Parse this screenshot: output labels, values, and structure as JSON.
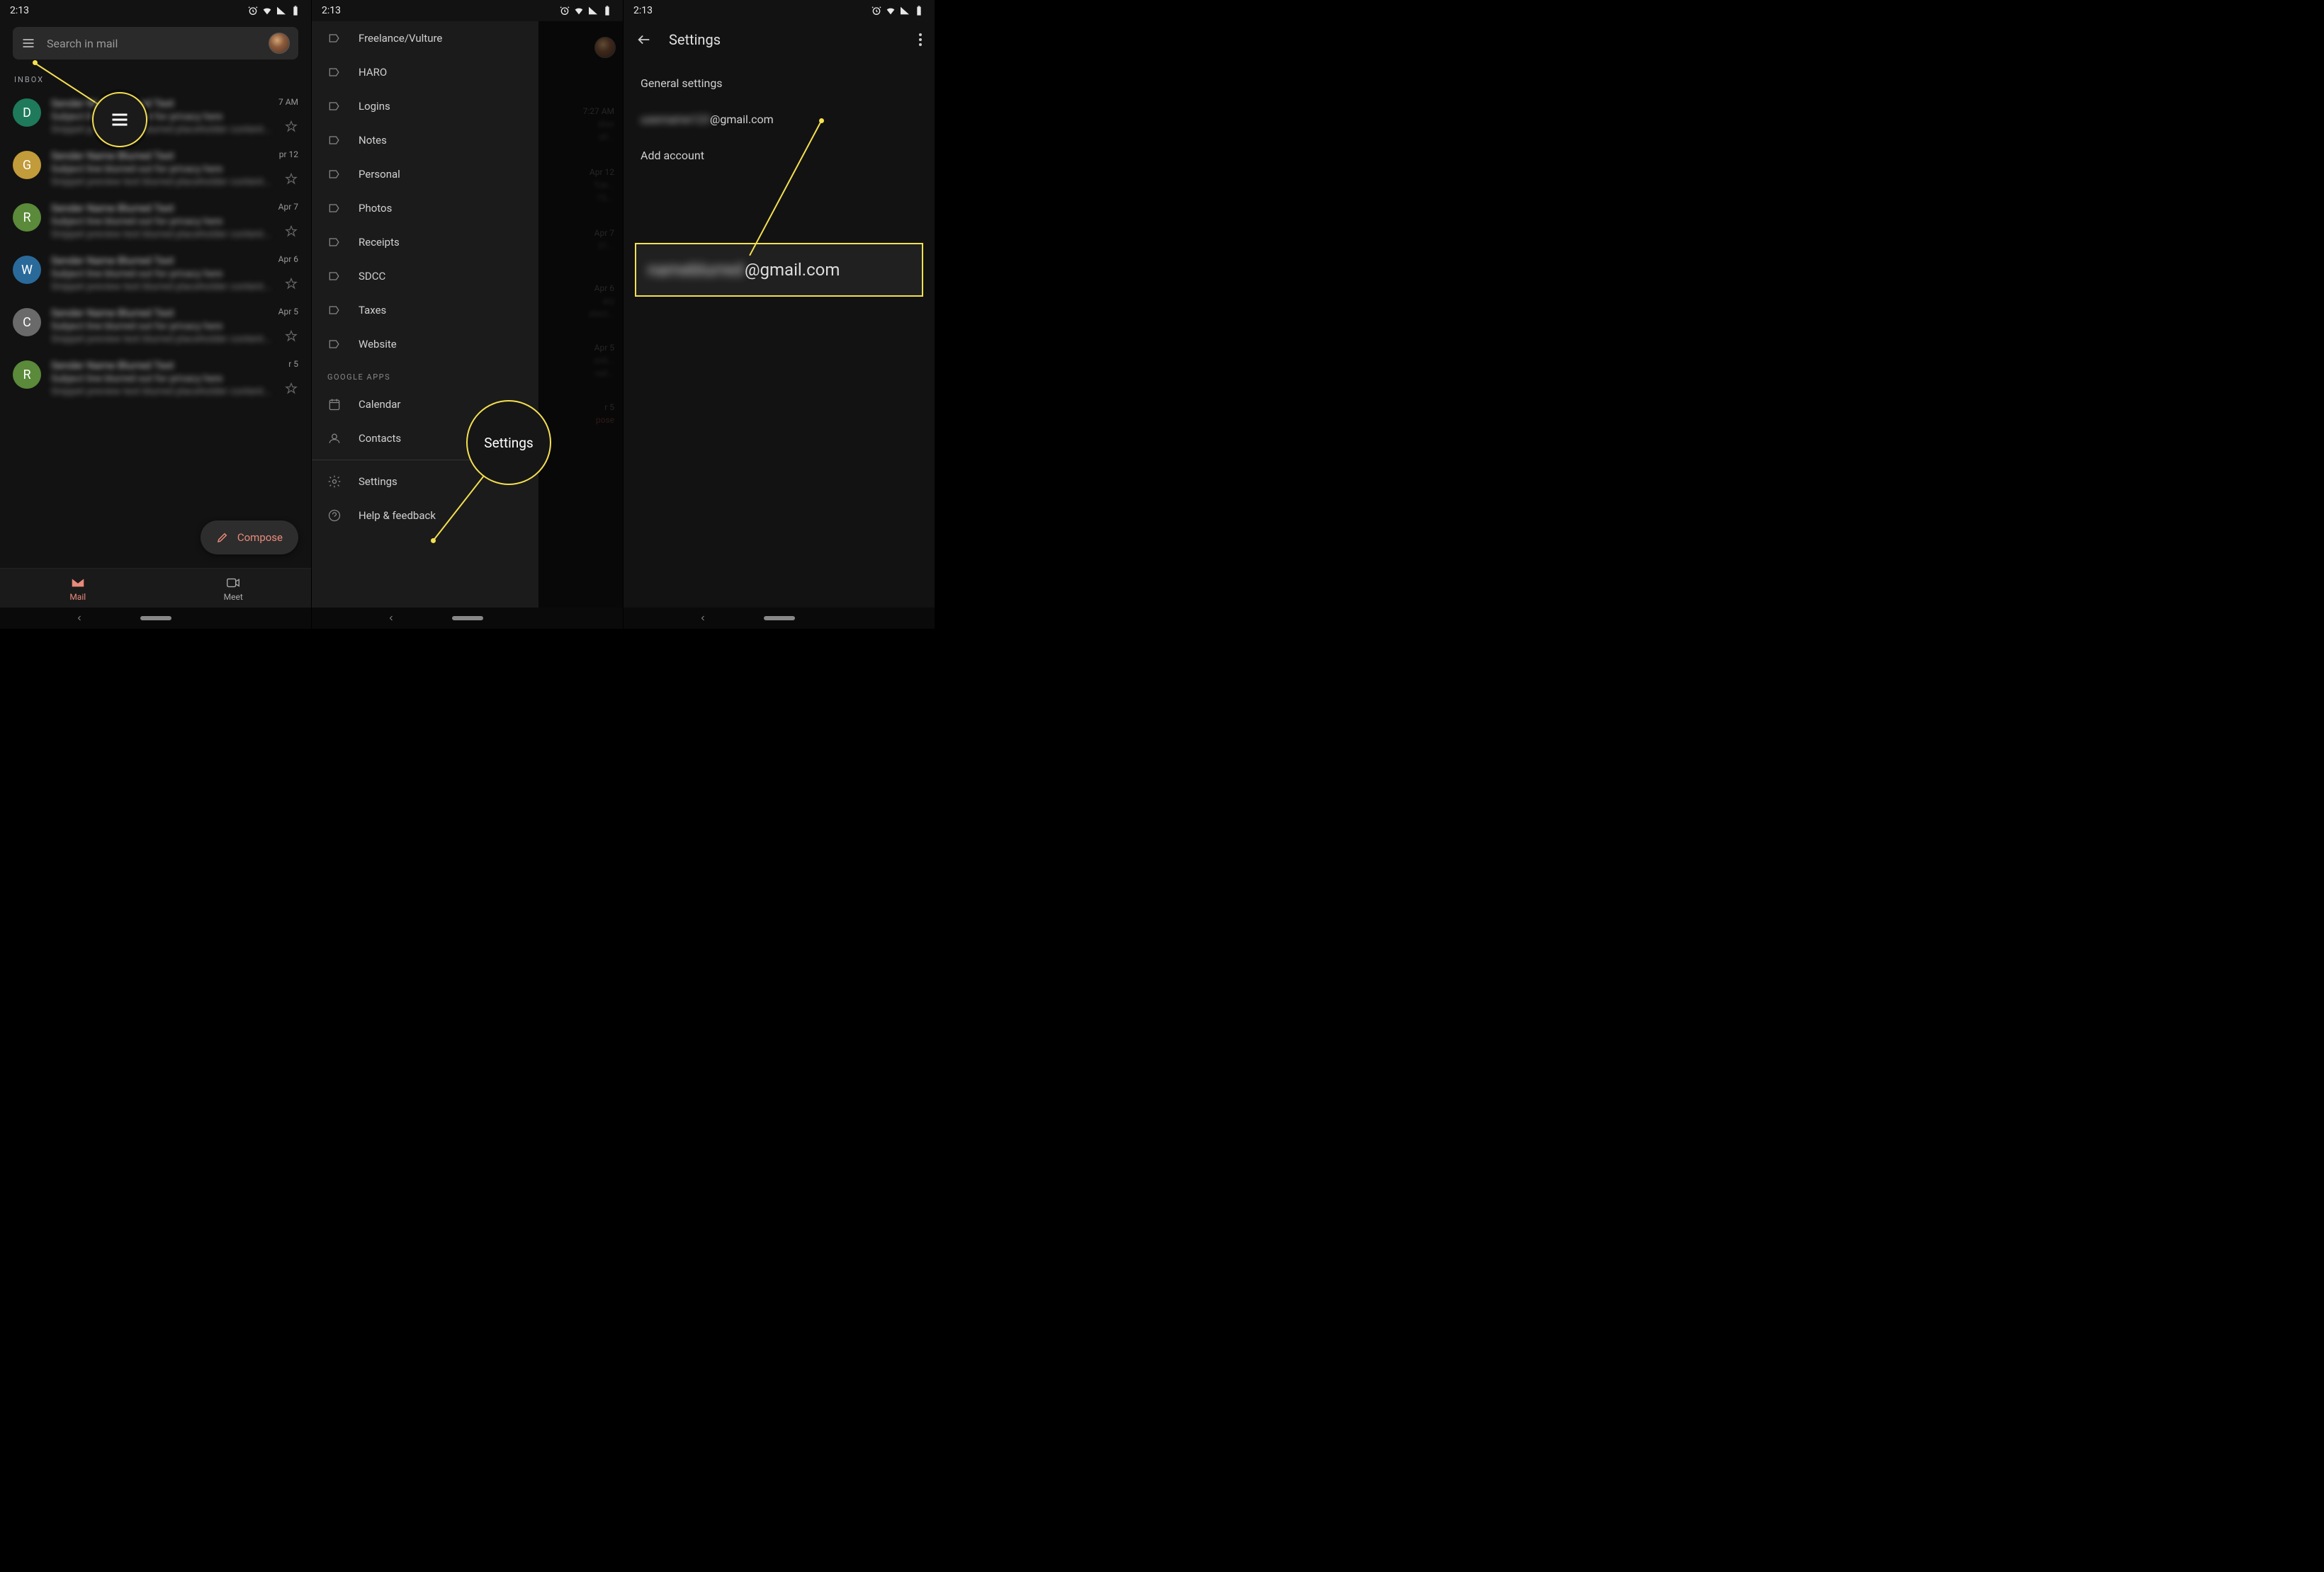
{
  "status": {
    "time": "2:13"
  },
  "screen1": {
    "search_placeholder": "Search in mail",
    "inbox_label": "INBOX",
    "emails": [
      {
        "avatar": "D",
        "avatarClass": "av-d",
        "time": "7 AM"
      },
      {
        "avatar": "G",
        "avatarClass": "av-g",
        "time": "pr 12"
      },
      {
        "avatar": "R",
        "avatarClass": "av-r",
        "time": "Apr 7"
      },
      {
        "avatar": "W",
        "avatarClass": "av-w",
        "time": "Apr 6"
      },
      {
        "avatar": "C",
        "avatarClass": "av-c",
        "time": "Apr 5"
      },
      {
        "avatar": "R",
        "avatarClass": "av-r2",
        "time": "r 5"
      }
    ],
    "compose": "Compose",
    "nav": {
      "mail": "Mail",
      "meet": "Meet"
    }
  },
  "screen2": {
    "labels": [
      "Freelance/Vulture",
      "HARO",
      "Logins",
      "Notes",
      "Personal",
      "Photos",
      "Receipts",
      "SDCC",
      "Taxes",
      "Website"
    ],
    "google_apps_header": "GOOGLE APPS",
    "apps": [
      "Calendar",
      "Contacts"
    ],
    "footer": [
      "Settings",
      "Help & feedback"
    ],
    "partial_times": [
      "7:27 AM",
      "Apr 12",
      "Apr 7",
      "Apr 6",
      "Apr 5",
      "r 5"
    ],
    "highlight_label": "Settings"
  },
  "screen3": {
    "title": "Settings",
    "items": {
      "general": "General settings",
      "account_suffix": "@gmail.com",
      "add_account": "Add account"
    },
    "highlight_suffix": "@gmail.com"
  }
}
